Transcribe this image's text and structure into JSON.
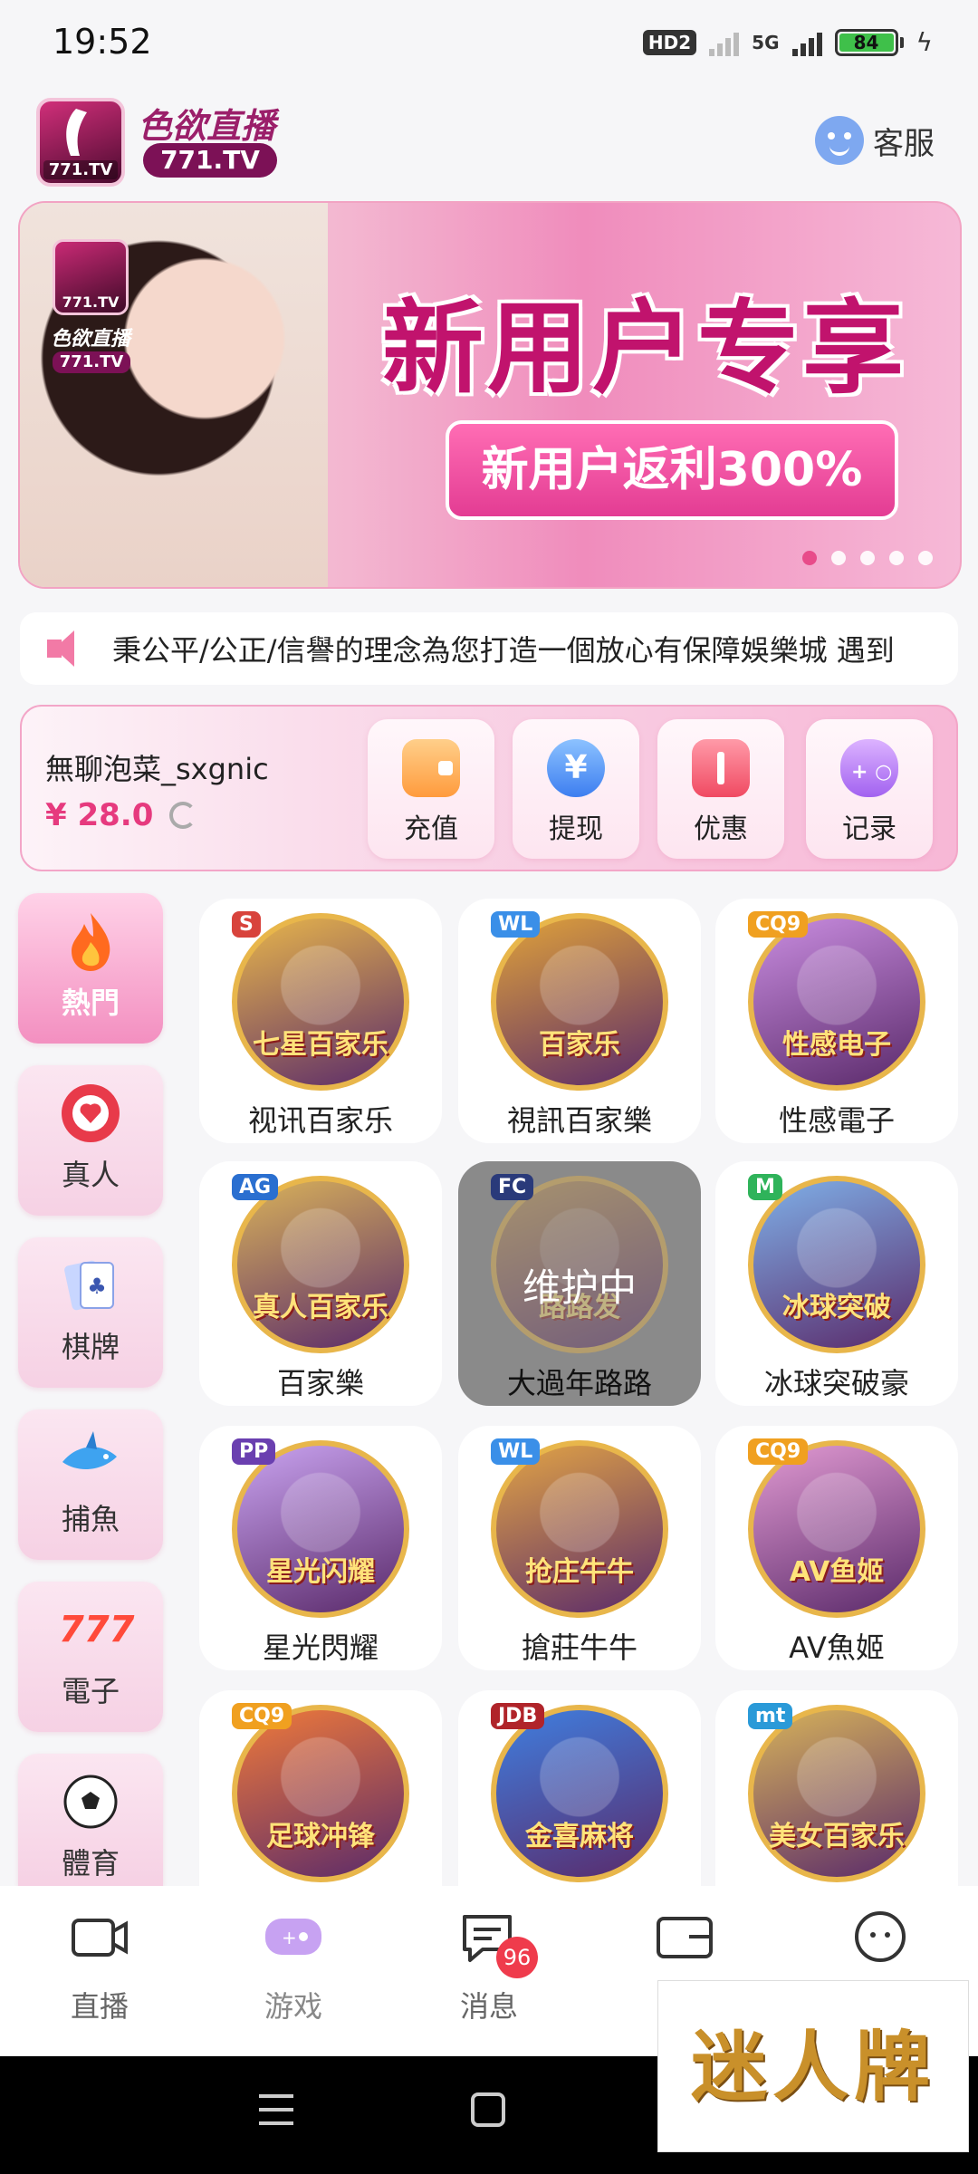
{
  "status": {
    "time": "19:52",
    "hd": "HD2",
    "net": "5G",
    "battery": "84"
  },
  "header": {
    "brand_title": "色欲直播",
    "brand_tag": "771.TV",
    "logo_mini": "771.TV",
    "service": "客服"
  },
  "banner": {
    "title": "新用户专享",
    "pill": "新用户返利300%",
    "logo_mini": "771.TV",
    "sub_brand": "色欲直播",
    "sub_tag": "771.TV",
    "dots_count": 5
  },
  "marquee": {
    "text": "秉公平/公正/信譽的理念為您打造一個放心有保障娛樂城  遇到"
  },
  "user": {
    "name": "無聊泡菜_sxgnic",
    "balance": "¥ 28.0",
    "actions": [
      {
        "label": "充值",
        "icon": "wallet-icon"
      },
      {
        "label": "提现",
        "icon": "yen-icon"
      },
      {
        "label": "优惠",
        "icon": "ticket-icon"
      },
      {
        "label": "记录",
        "icon": "gamepad-icon"
      }
    ]
  },
  "categories": [
    {
      "label": "熱門",
      "icon": "fire-icon",
      "active": true
    },
    {
      "label": "真人",
      "icon": "poker-chip-icon"
    },
    {
      "label": "棋牌",
      "icon": "cards-icon"
    },
    {
      "label": "捕魚",
      "icon": "shark-icon"
    },
    {
      "label": "電子",
      "icon": "slot-777-icon"
    },
    {
      "label": "體育",
      "icon": "soccer-ball-icon"
    }
  ],
  "games": [
    {
      "label": "视讯百家乐",
      "badge": "S",
      "art_text": "七星百家乐"
    },
    {
      "label": "視訊百家樂",
      "badge": "WL",
      "art_text": "百家乐"
    },
    {
      "label": "性感電子",
      "badge": "CQ9",
      "art_text": "性感电子"
    },
    {
      "label": "百家樂",
      "badge": "AG",
      "art_text": "真人百家乐"
    },
    {
      "label": "大過年路路",
      "badge": "FC",
      "art_text": "路路发",
      "maintenance": "维护中"
    },
    {
      "label": "冰球突破豪",
      "badge": "M",
      "art_text": "冰球突破"
    },
    {
      "label": "星光閃耀",
      "badge": "PP",
      "art_text": "星光闪耀"
    },
    {
      "label": "搶莊牛牛",
      "badge": "WL",
      "art_text": "抢庄牛牛"
    },
    {
      "label": "AV魚姬",
      "badge": "CQ9",
      "art_text": "AV鱼姬"
    },
    {
      "label": "",
      "badge": "CQ9",
      "art_text": "足球冲锋"
    },
    {
      "label": "",
      "badge": "JDB",
      "art_text": "金喜麻将"
    },
    {
      "label": "",
      "badge": "mt",
      "art_text": "美女百家乐"
    }
  ],
  "bottom_nav": [
    {
      "label": "直播",
      "icon": "camera-icon"
    },
    {
      "label": "游戏",
      "icon": "gamepad-icon",
      "active": true
    },
    {
      "label": "消息",
      "icon": "message-icon",
      "badge": "96"
    },
    {
      "label": "",
      "icon": "wallet-icon"
    },
    {
      "label": "",
      "icon": "smiley-icon"
    }
  ],
  "watermark": "迷人牌"
}
